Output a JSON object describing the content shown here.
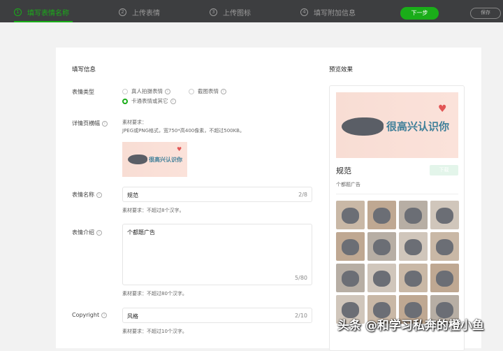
{
  "topbar": {
    "steps": [
      {
        "num": "1",
        "label": "填写表情名称"
      },
      {
        "num": "2",
        "label": "上传表情"
      },
      {
        "num": "3",
        "label": "上传图标"
      },
      {
        "num": "4",
        "label": "填写附加信息"
      }
    ],
    "next_label": "下一步",
    "save_label": "保存"
  },
  "form": {
    "section_title": "填写信息",
    "type": {
      "label": "表情类型",
      "options": [
        "真人拍摄表情",
        "截图表情",
        "卡通表情或其它"
      ],
      "selected": "卡通表情或其它"
    },
    "banner": {
      "label": "详情页横幅",
      "req_title": "素材要求：",
      "req_text": "JPEG或PNG格式，宽750*高400像素，不超过500KB。",
      "banner_text": "很高兴认识你"
    },
    "name": {
      "label": "表情名称",
      "value": "规范",
      "count": "2/8",
      "hint": "素材要求：不超过8个汉字。"
    },
    "intro": {
      "label": "表情介绍",
      "value": "个都题广告",
      "count": "5/80",
      "hint": "素材要求：不超过80个汉字。"
    },
    "copyright": {
      "label": "Copyright",
      "value": "风格",
      "count": "2/10",
      "hint": "素材要求：不超过10个汉字。"
    }
  },
  "preview": {
    "title": "预览效果",
    "banner_text": "很高兴认识你",
    "name": "规范",
    "button_label": "下载",
    "desc": "个都题广告"
  },
  "watermark": "头条 @和学习私奔的橙小鱼"
}
